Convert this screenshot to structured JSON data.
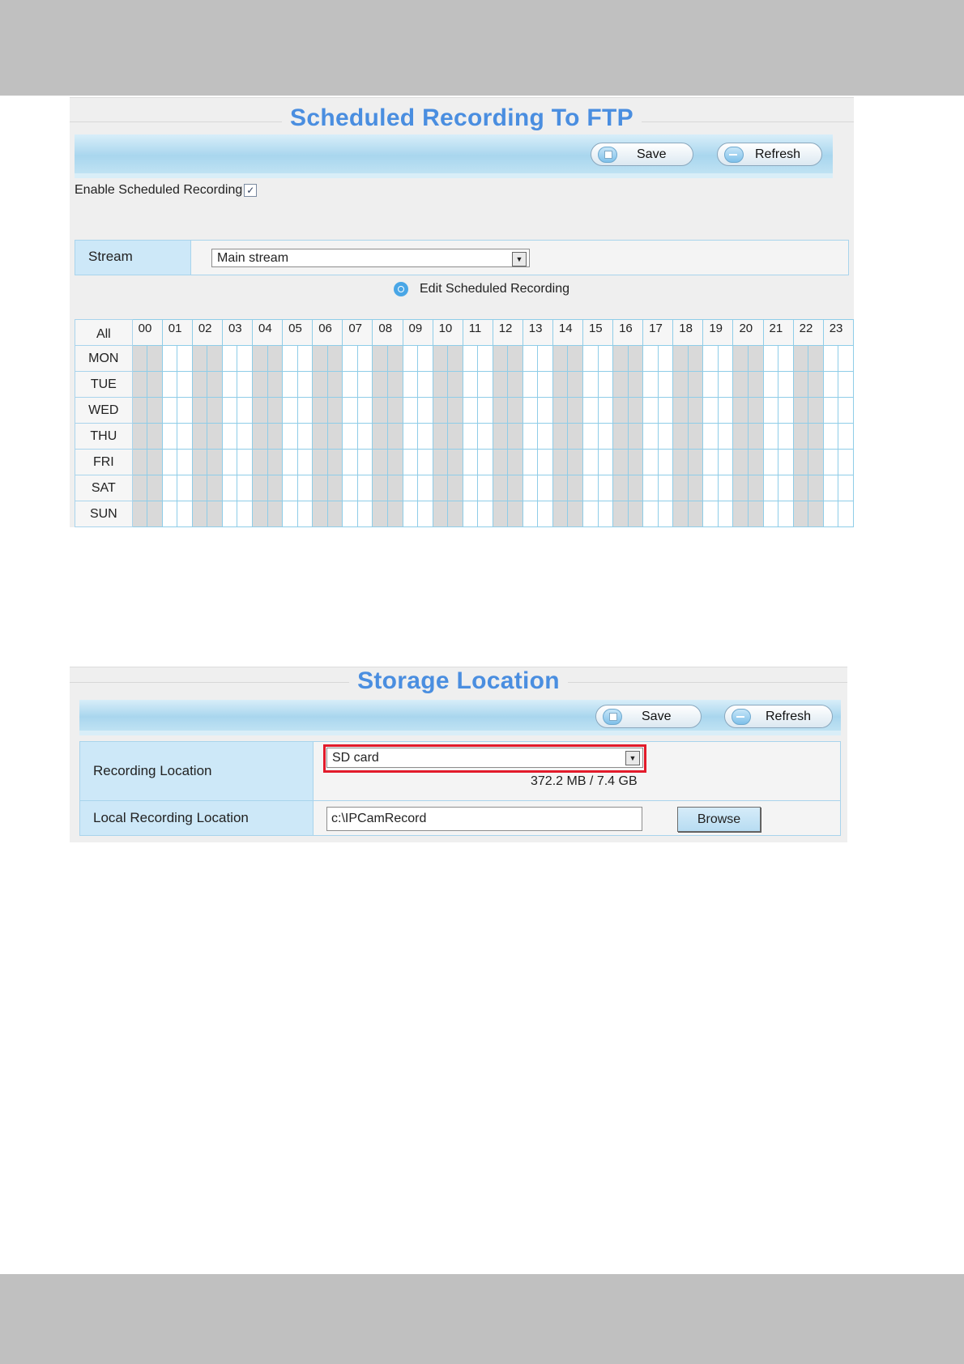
{
  "scheduled_recording": {
    "title": "Scheduled Recording To FTP",
    "save_label": "Save",
    "refresh_label": "Refresh",
    "enable_label": "Enable Scheduled Recording",
    "enable_checked": true,
    "stream_label": "Stream",
    "stream_value": "Main stream",
    "edit_label": "Edit Scheduled Recording",
    "all_label": "All",
    "hours": [
      "00",
      "01",
      "02",
      "03",
      "04",
      "05",
      "06",
      "07",
      "08",
      "09",
      "10",
      "11",
      "12",
      "13",
      "14",
      "15",
      "16",
      "17",
      "18",
      "19",
      "20",
      "21",
      "22",
      "23"
    ],
    "days": [
      "MON",
      "TUE",
      "WED",
      "THU",
      "FRI",
      "SAT",
      "SUN"
    ]
  },
  "storage_location": {
    "title": "Storage Location",
    "save_label": "Save",
    "refresh_label": "Refresh",
    "recording_location_label": "Recording Location",
    "recording_location_value": "SD card",
    "capacity_text": "372.2 MB / 7.4 GB",
    "local_location_label": "Local Recording Location",
    "local_location_value": "c:\\IPCamRecord",
    "browse_label": "Browse"
  },
  "colors": {
    "title": "#4a8ee0",
    "label_bg": "#cde8f8",
    "highlight": "#e21b2b"
  }
}
